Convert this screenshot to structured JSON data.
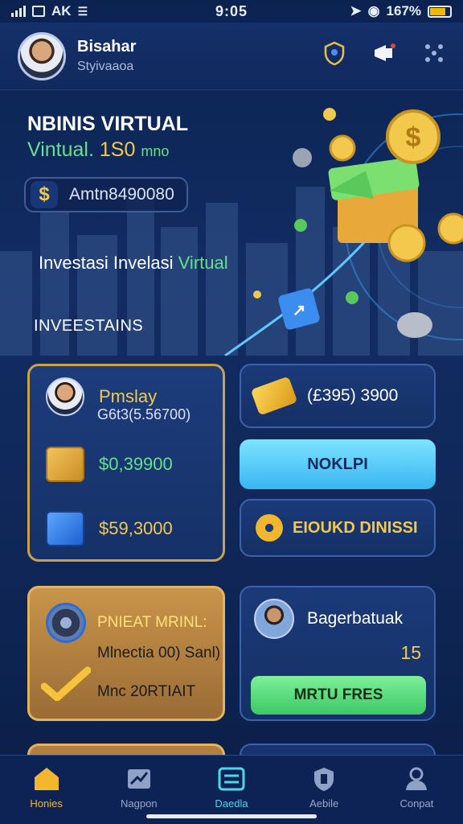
{
  "status": {
    "carrier": "AK",
    "time": "9:05",
    "battery": "167%",
    "battery_level": 0.8
  },
  "header": {
    "name": "Bisahar",
    "subtitle": "Styivaaoa",
    "icons": [
      "shield-icon",
      "megaphone-icon",
      "menu-dots-icon"
    ]
  },
  "hero": {
    "title": "NBINIS VIRTUAL",
    "sub_prefix": "Vintual.",
    "sub_value": "1S0",
    "sub_suffix": "mno",
    "balance_symbol": "$",
    "balance_value": "Amtn8490080",
    "invest_prefix": "Investasi Invelasi",
    "invest_highlight": "Virtual",
    "section_title": "INVEESTAINS"
  },
  "portfolio": {
    "name": "Pmslay",
    "value": "G6t3(5.56700)",
    "asset1_value": "$0,39900",
    "asset2_value": "$59,3000"
  },
  "side": {
    "gold_value": "(£395) 3900",
    "cyan_button": "NOKLPI",
    "gear_label": "EIOUKD DINISSI"
  },
  "promo": {
    "title": "PNIEAT MRINL:",
    "line": "Mlnectia 00) Sanl)",
    "bottom": "Mnc 20RTIAIT"
  },
  "agent": {
    "title": "Bagerbatuak",
    "count": "15",
    "button": "MRTU FRES"
  },
  "nav": {
    "items": [
      {
        "label": "Honies",
        "icon": "home-icon"
      },
      {
        "label": "Nagpon",
        "icon": "chart-icon"
      },
      {
        "label": "Daedla",
        "icon": "list-icon"
      },
      {
        "label": "Aebile",
        "icon": "shield-badge-icon"
      },
      {
        "label": "Conpat",
        "icon": "user-icon"
      }
    ]
  },
  "colors": {
    "accent_gold": "#f2c94c",
    "accent_green": "#66e08a",
    "accent_cyan": "#4fd6e8",
    "background": "#122d63"
  }
}
